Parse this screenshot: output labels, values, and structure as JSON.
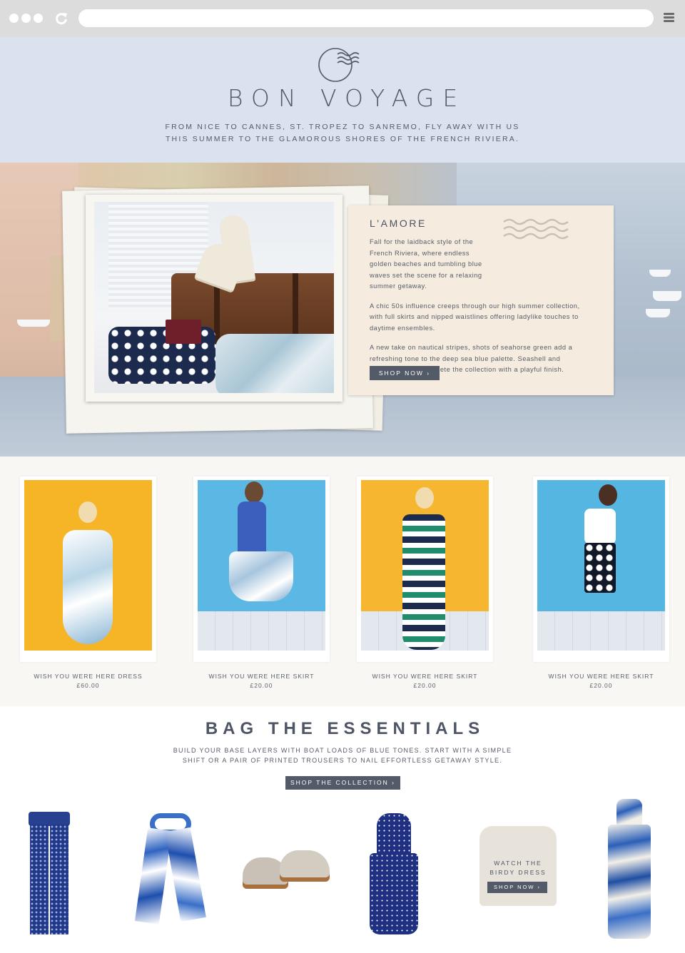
{
  "browser": {
    "icons": [
      "circle-dot",
      "circle-dot",
      "circle-dot",
      "reload-icon",
      "hamburger-menu-icon"
    ]
  },
  "hero": {
    "brand": "BON VOYAGE",
    "tagline_line1": "FROM NICE TO CANNES, ST. TROPEZ TO SANREMO, FLY AWAY WITH US",
    "tagline_line2": "THIS SUMMER TO THE GLAMOROUS SHORES OF THE FRENCH RIVIERA."
  },
  "postcard": {
    "title": "L'AMORE",
    "paragraph1": "Fall for the laidback style of the French Riviera, where endless golden beaches and tumbling blue waves set the scene for a relaxing summer getaway.",
    "paragraph2": "A chic 50s influence creeps through our high summer collection, with full skirts and nipped waistlines offering ladylike touches to daytime ensembles.",
    "paragraph3": "A new take on nautical stripes, shots of seahorse green add a refreshing tone to the deep sea blue palette. Seashell and postcard prints complete the collection with a playful finish.",
    "button": "SHOP NOW ›"
  },
  "products": [
    {
      "name": "WISH YOU WERE HERE DRESS",
      "price": "£60.00",
      "bg": "#f6b527"
    },
    {
      "name": "WISH YOU WERE HERE SKIRT",
      "price": "£20.00",
      "bg": "#5bb8e4"
    },
    {
      "name": "WISH YOU WERE HERE SKIRT",
      "price": "£20.00",
      "bg": "#f6b630"
    },
    {
      "name": "WISH YOU WERE HERE SKIRT",
      "price": "£20.00",
      "bg": "#56b6e2"
    }
  ],
  "essentials": {
    "title": "BAG THE ESSENTIALS",
    "subtitle_line1": "BUILD YOUR BASE LAYERS WITH BOAT LOADS OF BLUE TONES. START WITH A SIMPLE",
    "subtitle_line2": "SHIFT OR A PAIR OF PRINTED TROUSERS TO NAIL EFFORTLESS GETAWAY STYLE.",
    "button": "SHOP THE COLLECTION ›",
    "watch_line1": "WATCH THE",
    "watch_line2": "BIRDY DRESS",
    "watch_button": "SHOP NOW ›"
  },
  "colors": {
    "accent": "#535a68",
    "hero_bg": "#d9e2ee",
    "postcard_bg": "#f5ecdf"
  }
}
